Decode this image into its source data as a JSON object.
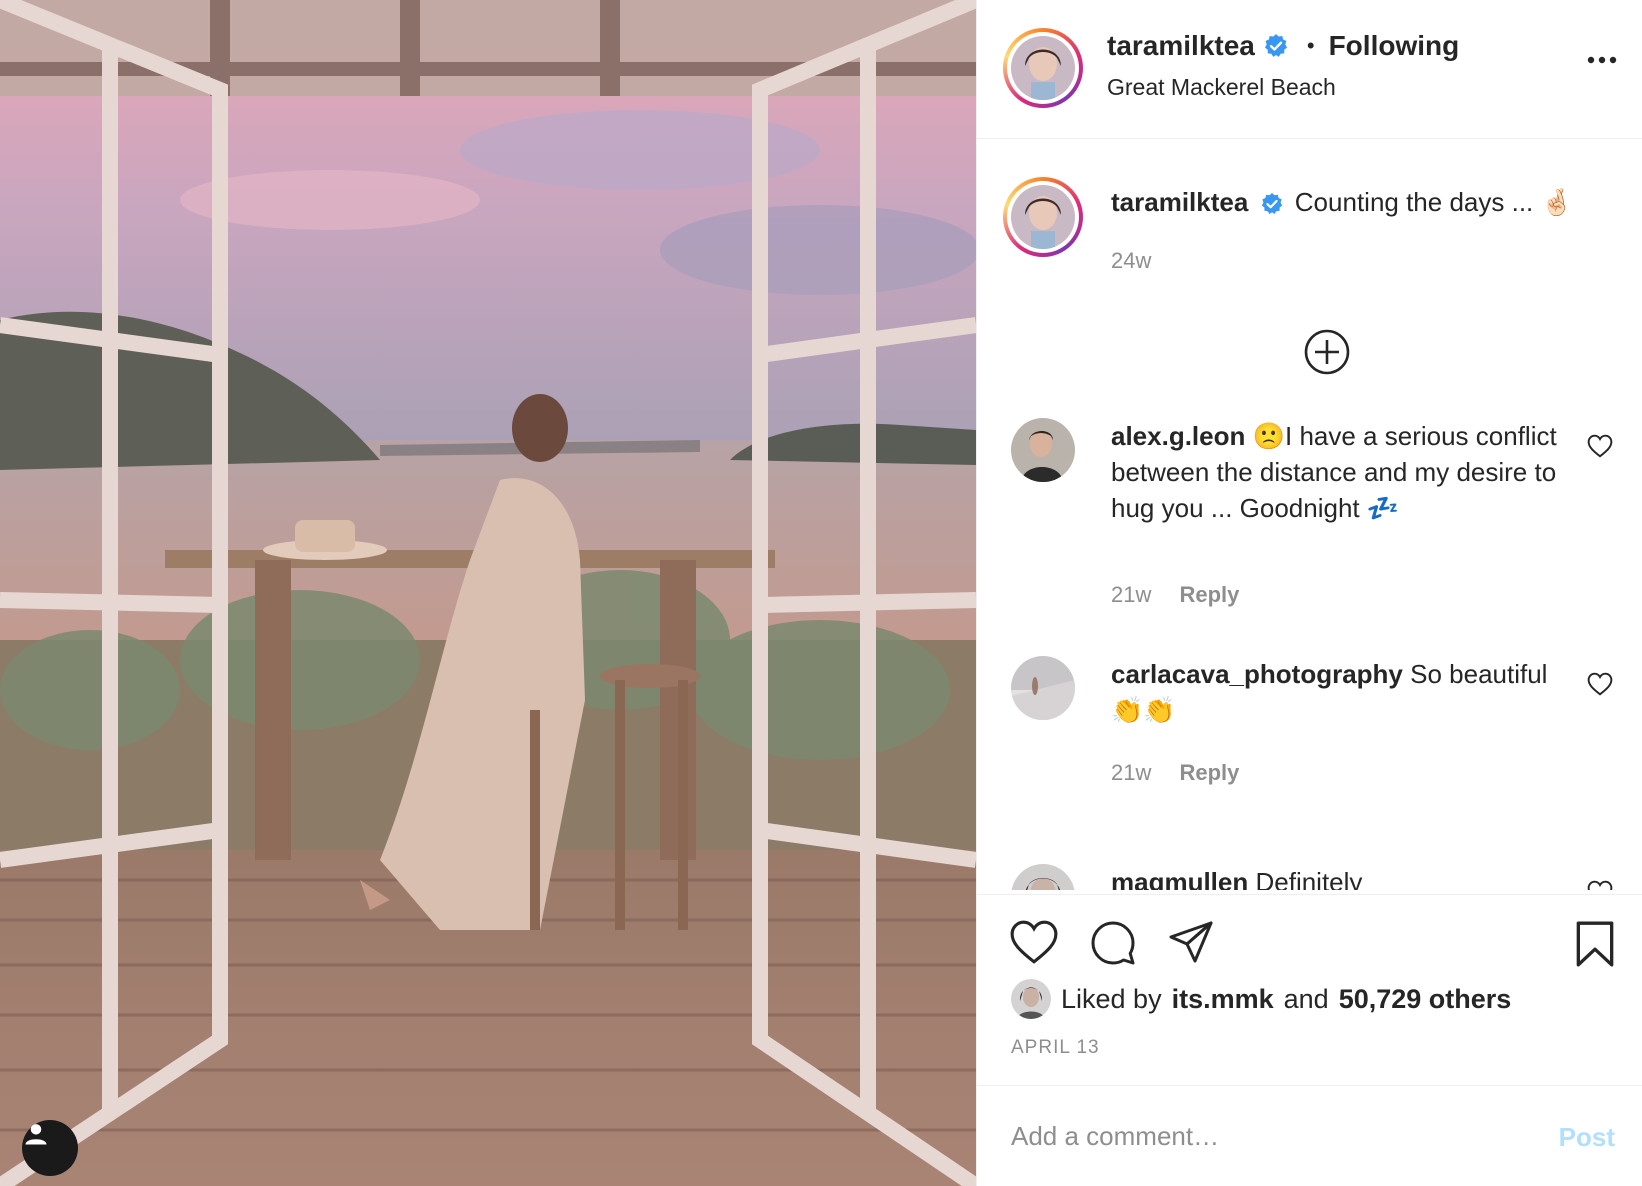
{
  "post": {
    "username": "taramilktea",
    "follow_status": "Following",
    "location": "Great Mackerel Beach",
    "caption": "Counting the days ... 🤞🏻",
    "caption_time": "24w"
  },
  "comments": [
    {
      "username": "alex.g.leon",
      "text": "🙁I have a serious conflict between the distance and my desire to hug you ... Goodnight 💤",
      "time": "21w",
      "reply": "Reply"
    },
    {
      "username": "carlacava_photography",
      "text": "So beautiful 👏👏",
      "time": "21w",
      "reply": "Reply"
    },
    {
      "username": "magmullen",
      "text": "Definitely",
      "time": "",
      "reply": ""
    }
  ],
  "likes": {
    "prefix": "Liked by",
    "user": "its.mmk",
    "conjunction": "and",
    "others": "50,729 others"
  },
  "date": "APRIL 13",
  "comment_box": {
    "placeholder": "Add a comment…",
    "post_label": "Post"
  },
  "colors": {
    "verified": "#3897f0",
    "post_disabled": "#b2dffc",
    "secondary_text": "#8e8e8e"
  },
  "icons": [
    "heart-icon",
    "comment-icon",
    "share-icon",
    "bookmark-icon",
    "more-icon",
    "plus-circle-icon",
    "verified-badge-icon",
    "user-tag-icon"
  ]
}
